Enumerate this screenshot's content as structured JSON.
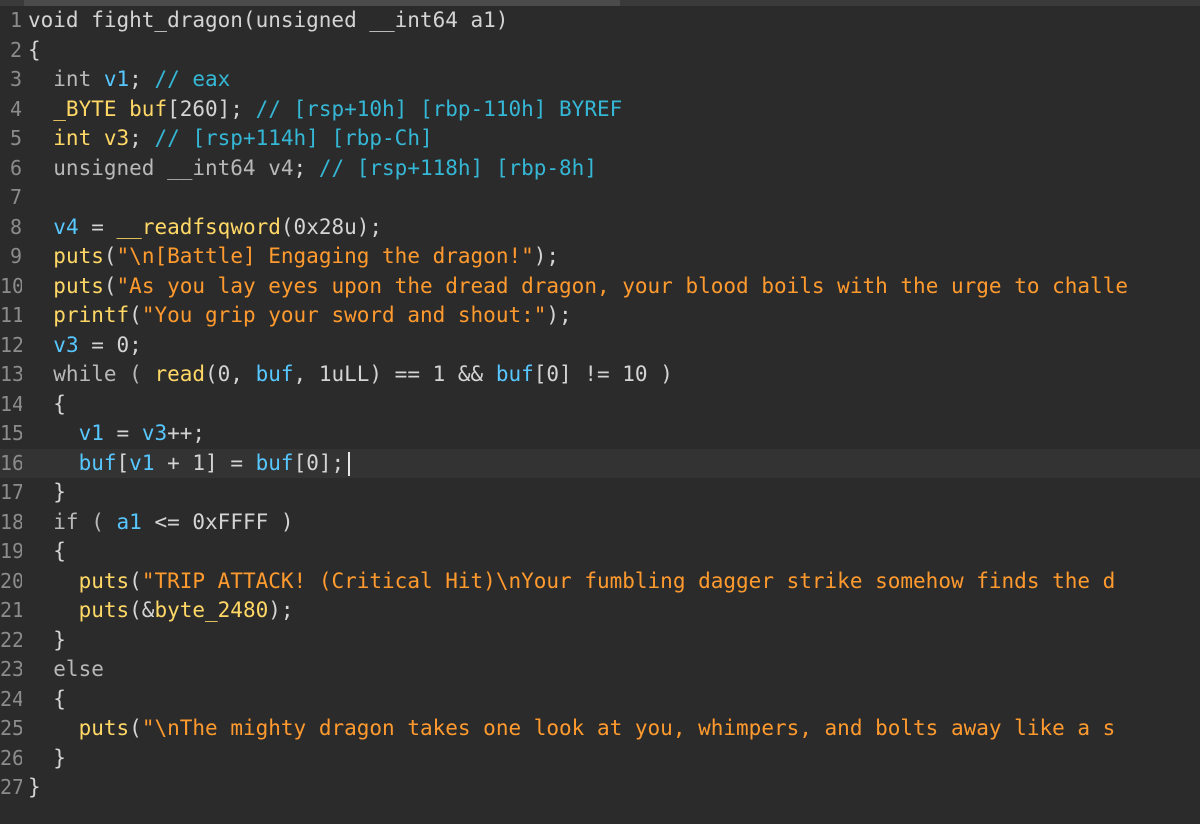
{
  "editor": {
    "colors": {
      "background": "#2b2b2b",
      "plain": "#d4d4d4",
      "type": "#b8b8b8",
      "var": "#57c7ff",
      "num": "#d4d4d4",
      "str": "#ff9a2e",
      "comment": "#35b7d6",
      "func": "#ffd866",
      "linenum": "#8c8c8c"
    },
    "lines": [
      {
        "n": "1",
        "tokens": [
          [
            "void fight_dragon(unsigned __int64 a1)",
            "plain"
          ]
        ]
      },
      {
        "n": "2",
        "tokens": [
          [
            "{",
            "plain"
          ]
        ]
      },
      {
        "n": "3",
        "tokens": [
          [
            "  int ",
            "type"
          ],
          [
            "v1",
            "var"
          ],
          [
            "; ",
            "plain"
          ],
          [
            "// eax",
            "comment"
          ]
        ]
      },
      {
        "n": "4",
        "tokens": [
          [
            "  _BYTE ",
            "func"
          ],
          [
            "buf",
            "func"
          ],
          [
            "[260]; ",
            "plain"
          ],
          [
            "// [rsp+10h] [rbp-110h] BYREF",
            "comment"
          ]
        ]
      },
      {
        "n": "5",
        "tokens": [
          [
            "  int ",
            "func"
          ],
          [
            "v3",
            "func"
          ],
          [
            "; ",
            "plain"
          ],
          [
            "// [rsp+114h] [rbp-Ch]",
            "comment"
          ]
        ]
      },
      {
        "n": "6",
        "tokens": [
          [
            "  unsigned __int64 ",
            "type"
          ],
          [
            "v4",
            "type"
          ],
          [
            "; ",
            "plain"
          ],
          [
            "// [rsp+118h] [rbp-8h]",
            "comment"
          ]
        ]
      },
      {
        "n": "7",
        "tokens": [
          [
            "",
            "plain"
          ]
        ]
      },
      {
        "n": "8",
        "tokens": [
          [
            "  ",
            "plain"
          ],
          [
            "v4",
            "var"
          ],
          [
            " = ",
            "plain"
          ],
          [
            "__readfsqword",
            "func"
          ],
          [
            "(0x28u);",
            "plain"
          ]
        ]
      },
      {
        "n": "9",
        "tokens": [
          [
            "  ",
            "plain"
          ],
          [
            "puts",
            "func"
          ],
          [
            "(",
            "plain"
          ],
          [
            "\"\\n[Battle] Engaging the dragon!\"",
            "str"
          ],
          [
            ");",
            "plain"
          ]
        ]
      },
      {
        "n": "10",
        "tokens": [
          [
            "  ",
            "plain"
          ],
          [
            "puts",
            "func"
          ],
          [
            "(",
            "plain"
          ],
          [
            "\"As you lay eyes upon the dread dragon, your blood boils with the urge to challe",
            "str"
          ]
        ]
      },
      {
        "n": "11",
        "tokens": [
          [
            "  ",
            "plain"
          ],
          [
            "printf",
            "func"
          ],
          [
            "(",
            "plain"
          ],
          [
            "\"You grip your sword and shout:\"",
            "str"
          ],
          [
            ");",
            "plain"
          ]
        ]
      },
      {
        "n": "12",
        "tokens": [
          [
            "  ",
            "plain"
          ],
          [
            "v3",
            "var"
          ],
          [
            " = 0;",
            "plain"
          ]
        ]
      },
      {
        "n": "13",
        "tokens": [
          [
            "  while ( ",
            "type"
          ],
          [
            "read",
            "func"
          ],
          [
            "(0, ",
            "plain"
          ],
          [
            "buf",
            "var"
          ],
          [
            ", 1uLL) == 1 && ",
            "plain"
          ],
          [
            "buf",
            "var"
          ],
          [
            "[0] != 10 )",
            "plain"
          ]
        ]
      },
      {
        "n": "14",
        "tokens": [
          [
            "  {",
            "plain"
          ]
        ]
      },
      {
        "n": "15",
        "tokens": [
          [
            "    ",
            "plain"
          ],
          [
            "v1",
            "var"
          ],
          [
            " = ",
            "plain"
          ],
          [
            "v3",
            "var"
          ],
          [
            "++;",
            "plain"
          ]
        ]
      },
      {
        "n": "16",
        "tokens": [
          [
            "    ",
            "plain"
          ],
          [
            "buf",
            "var"
          ],
          [
            "[",
            "plain"
          ],
          [
            "v1",
            "var"
          ],
          [
            " + 1] = ",
            "plain"
          ],
          [
            "buf",
            "var"
          ],
          [
            "[0];",
            "plain"
          ]
        ],
        "current": true
      },
      {
        "n": "17",
        "tokens": [
          [
            "  }",
            "plain"
          ]
        ]
      },
      {
        "n": "18",
        "tokens": [
          [
            "  if ( ",
            "type"
          ],
          [
            "a1",
            "var"
          ],
          [
            " <= 0xFFFF )",
            "plain"
          ]
        ]
      },
      {
        "n": "19",
        "tokens": [
          [
            "  {",
            "plain"
          ]
        ]
      },
      {
        "n": "20",
        "tokens": [
          [
            "    ",
            "plain"
          ],
          [
            "puts",
            "func"
          ],
          [
            "(",
            "plain"
          ],
          [
            "\"TRIP ATTACK! (Critical Hit)\\nYour fumbling dagger strike somehow finds the d",
            "str"
          ]
        ]
      },
      {
        "n": "21",
        "tokens": [
          [
            "    ",
            "plain"
          ],
          [
            "puts",
            "func"
          ],
          [
            "(&",
            "plain"
          ],
          [
            "byte_2480",
            "func"
          ],
          [
            ");",
            "plain"
          ]
        ]
      },
      {
        "n": "22",
        "tokens": [
          [
            "  }",
            "plain"
          ]
        ]
      },
      {
        "n": "23",
        "tokens": [
          [
            "  else",
            "type"
          ]
        ]
      },
      {
        "n": "24",
        "tokens": [
          [
            "  {",
            "plain"
          ]
        ]
      },
      {
        "n": "25",
        "tokens": [
          [
            "    ",
            "plain"
          ],
          [
            "puts",
            "func"
          ],
          [
            "(",
            "plain"
          ],
          [
            "\"\\nThe mighty dragon takes one look at you, whimpers, and bolts away like a s",
            "str"
          ]
        ]
      },
      {
        "n": "26",
        "tokens": [
          [
            "  }",
            "plain"
          ]
        ]
      },
      {
        "n": "27",
        "tokens": [
          [
            "}",
            "plain"
          ]
        ]
      }
    ]
  }
}
